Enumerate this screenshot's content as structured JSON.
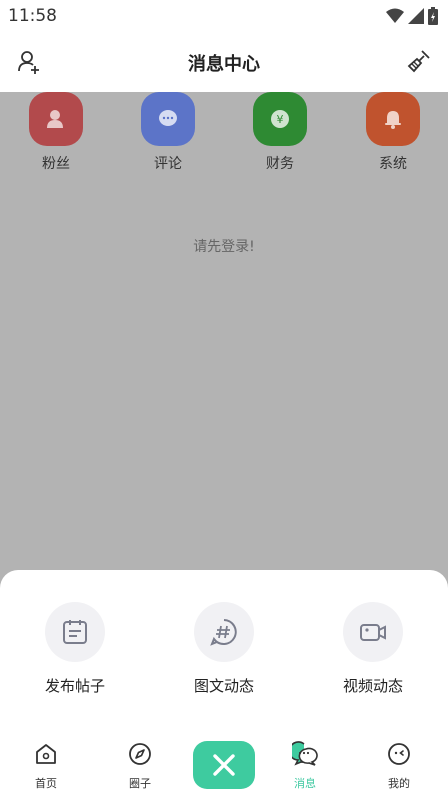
{
  "status": {
    "time": "11:58"
  },
  "header": {
    "title": "消息中心",
    "left_icon": "add-user-icon",
    "right_icon": "broom-icon"
  },
  "categories": [
    {
      "label": "粉丝",
      "color": "#b24a4c",
      "icon": "fans-icon"
    },
    {
      "label": "评论",
      "color": "#5c74c8",
      "icon": "comment-icon"
    },
    {
      "label": "财务",
      "color": "#2e8a33",
      "icon": "finance-icon"
    },
    {
      "label": "系统",
      "color": "#c0532e",
      "icon": "bell-icon"
    }
  ],
  "login_hint": "请先登录!",
  "sheet": {
    "actions": [
      {
        "label": "发布帖子",
        "icon": "post-icon"
      },
      {
        "label": "图文动态",
        "icon": "hashtag-icon"
      },
      {
        "label": "视频动态",
        "icon": "video-icon"
      }
    ]
  },
  "tabbar": {
    "tabs": [
      {
        "label": "首页",
        "icon": "home-icon"
      },
      {
        "label": "圈子",
        "icon": "compass-icon"
      },
      {
        "label": "消息",
        "icon": "message-icon",
        "active": true
      },
      {
        "label": "我的",
        "icon": "profile-icon"
      }
    ],
    "center_icon": "close-icon",
    "accent": "#3ecb9f"
  }
}
